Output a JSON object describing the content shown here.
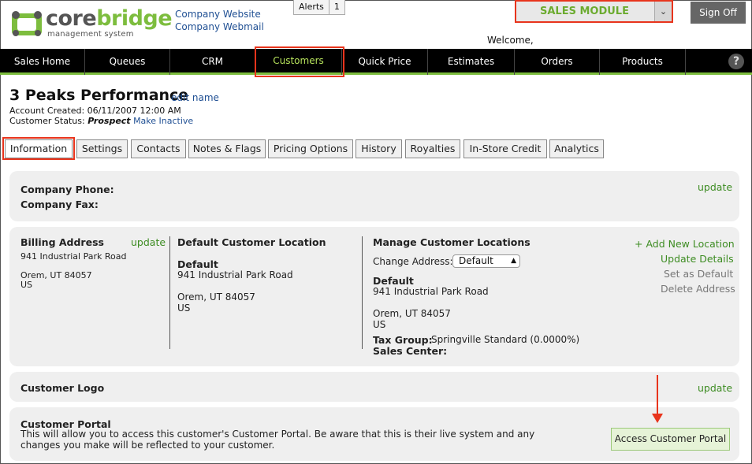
{
  "header": {
    "logo_core": "core",
    "logo_bridge": "bridge",
    "logo_sub": "management system",
    "company_website": "Company Website",
    "company_webmail": "Company Webmail",
    "alerts_label": "Alerts",
    "alerts_count": "1",
    "module_label": "SALES MODULE",
    "sign_off": "Sign Off",
    "welcome": "Welcome,"
  },
  "nav": {
    "items": [
      "Sales Home",
      "Queues",
      "CRM",
      "Customers",
      "Quick Price",
      "Estimates",
      "Orders",
      "Products"
    ],
    "active": "Customers",
    "help": "?"
  },
  "account": {
    "name": "3 Peaks Performance",
    "edit_name": "edit name",
    "created_label": "Account Created:",
    "created_value": "06/11/2007 12:00 AM",
    "status_label": "Customer Status:",
    "status_value": "Prospect",
    "make_inactive": "Make Inactive"
  },
  "tabs": [
    "Information",
    "Settings",
    "Contacts",
    "Notes & Flags",
    "Pricing Options",
    "History",
    "Royalties",
    "In-Store Credit",
    "Analytics"
  ],
  "phone_panel": {
    "phone_label": "Company Phone:",
    "fax_label": "Company Fax:",
    "update": "update"
  },
  "billing": {
    "title": "Billing Address",
    "update": "update",
    "street": "941 Industrial Park Road",
    "city": "Orem, UT 84057",
    "country": "US"
  },
  "default_location": {
    "title": "Default Customer Location",
    "name": "Default",
    "street": "941 Industrial Park Road",
    "city": "Orem, UT 84057",
    "country": "US"
  },
  "manage_locations": {
    "title": "Manage Customer Locations",
    "change_label": "Change Address:",
    "selected": "Default",
    "name": "Default",
    "street": "941 Industrial Park Road",
    "city": "Orem, UT 84057",
    "country": "US",
    "tax_label": "Tax Group:",
    "tax_value": "Springville Standard (0.0000%)",
    "sales_center_label": "Sales Center:",
    "add_new": "+ Add New Location",
    "update_details": "Update Details",
    "set_default": "Set as Default",
    "delete_address": "Delete Address"
  },
  "logo_panel": {
    "title": "Customer Logo",
    "update": "update"
  },
  "portal_panel": {
    "title": "Customer Portal",
    "line1": "This will allow you to access this customer's Customer Portal. Be aware that this is their live system and any",
    "line2": "changes you make will be reflected to your customer.",
    "button": "Access Customer Portal"
  },
  "colors": {
    "accent_green": "#7dbd3e",
    "highlight_red": "#e8341c",
    "link_blue": "#1f4f93"
  }
}
